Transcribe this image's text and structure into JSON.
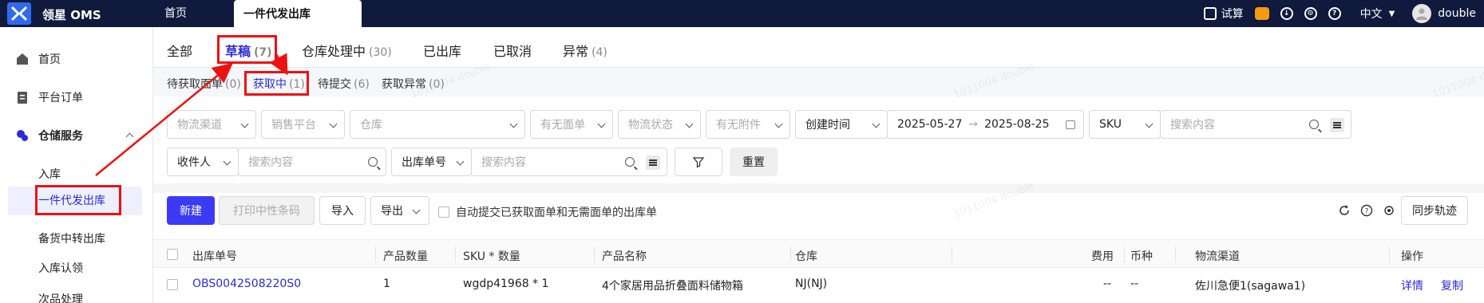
{
  "topbar": {
    "app_name": "领星 OMS",
    "tabs": [
      {
        "label": "首页"
      },
      {
        "label": "一件代发出库"
      }
    ],
    "trial": "试算",
    "language": "中文",
    "user": "double"
  },
  "sidebar": {
    "items": [
      {
        "label": "首页",
        "icon": "home-icon"
      },
      {
        "label": "平台订单",
        "icon": "clipboard-icon"
      },
      {
        "label": "仓储服务",
        "icon": "warehouse-icon"
      }
    ],
    "sub_items": [
      {
        "label": "入库"
      },
      {
        "label": "一件代发出库"
      },
      {
        "label": "备货中转出库"
      },
      {
        "label": "入库认领"
      },
      {
        "label": "次品处理"
      }
    ]
  },
  "main_tabs": [
    {
      "label": "全部",
      "count": ""
    },
    {
      "label": "草稿",
      "count": "(7)"
    },
    {
      "label": "仓库处理中",
      "count": "(30)"
    },
    {
      "label": "已出库",
      "count": ""
    },
    {
      "label": "已取消",
      "count": ""
    },
    {
      "label": "异常",
      "count": "(4)"
    }
  ],
  "sub_tabs": [
    {
      "label": "待获取面单",
      "count": "(0)"
    },
    {
      "label": "获取中",
      "count": "(1)"
    },
    {
      "label": "待提交",
      "count": "(6)"
    },
    {
      "label": "获取异常",
      "count": "(0)"
    }
  ],
  "filters": {
    "logistics_channel": "物流渠道",
    "sales_platform": "销售平台",
    "warehouse": "仓库",
    "has_label": "有无面单",
    "logistics_status": "物流状态",
    "has_attachment": "有无附件",
    "date_type": "创建时间",
    "date_start": "2025-05-27",
    "date_arrow": "→",
    "date_end": "2025-08-25",
    "sku_type": "SKU",
    "search_placeholder": "搜索内容",
    "recipient_type": "收件人",
    "recipient_placeholder": "搜索内容",
    "order_no_type": "出库单号",
    "order_no_placeholder": "搜索内容",
    "reset": "重置"
  },
  "toolbar": {
    "new": "新建",
    "print_barcode": "打印中性条码",
    "import": "导入",
    "export": "导出",
    "auto_submit": "自动提交已获取面单和无需面单的出库单",
    "sync": "同步轨迹"
  },
  "table": {
    "headers": [
      "出库单号",
      "产品数量",
      "SKU * 数量",
      "产品名称",
      "仓库",
      "费用",
      "币种",
      "物流渠道",
      "操作"
    ],
    "rows": [
      {
        "order_no": "OBS0042508220S0",
        "qty": "1",
        "sku": "wgdp41968 * 1",
        "product": "4个家居用品折叠面料储物箱",
        "warehouse": "NJ(NJ)",
        "fee": "--",
        "currency": "--",
        "channel": "佐川急便1(sagawa1)",
        "action_detail": "详情",
        "action_copy": "复制"
      }
    ]
  },
  "watermark": "1011004 double"
}
